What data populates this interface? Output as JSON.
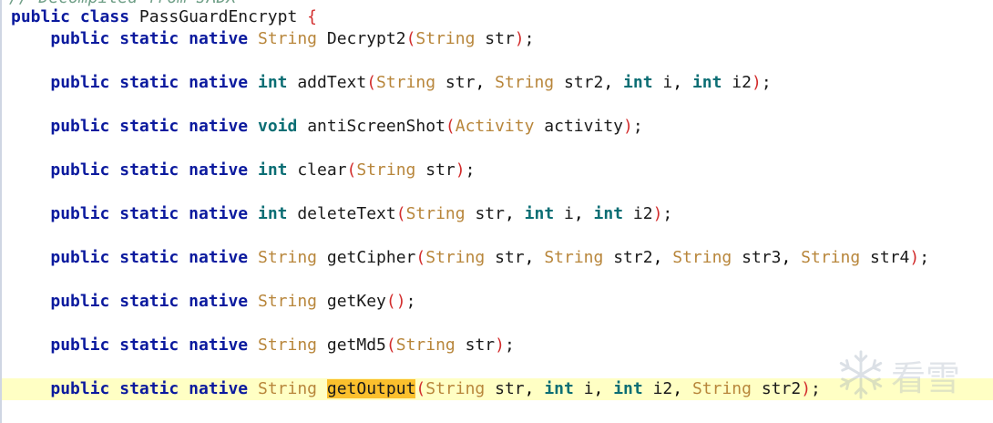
{
  "editor": {
    "top_comment_partial": "// Decompiled from JADX",
    "class_header": {
      "modifiers": [
        "public",
        "class"
      ],
      "name": "PassGuardEncrypt",
      "brace": "{"
    },
    "methods": [
      {
        "modifiers": [
          "public",
          "static",
          "native"
        ],
        "return_type": "String",
        "name": "Decrypt2",
        "params": [
          {
            "type": "String",
            "name": "str"
          }
        ]
      },
      {
        "modifiers": [
          "public",
          "static",
          "native"
        ],
        "return_type": "int",
        "name": "addText",
        "params": [
          {
            "type": "String",
            "name": "str"
          },
          {
            "type": "String",
            "name": "str2"
          },
          {
            "type": "int",
            "name": "i"
          },
          {
            "type": "int",
            "name": "i2"
          }
        ]
      },
      {
        "modifiers": [
          "public",
          "static",
          "native"
        ],
        "return_type": "void",
        "name": "antiScreenShot",
        "params": [
          {
            "type": "Activity",
            "name": "activity"
          }
        ]
      },
      {
        "modifiers": [
          "public",
          "static",
          "native"
        ],
        "return_type": "int",
        "name": "clear",
        "params": [
          {
            "type": "String",
            "name": "str"
          }
        ]
      },
      {
        "modifiers": [
          "public",
          "static",
          "native"
        ],
        "return_type": "int",
        "name": "deleteText",
        "params": [
          {
            "type": "String",
            "name": "str"
          },
          {
            "type": "int",
            "name": "i"
          },
          {
            "type": "int",
            "name": "i2"
          }
        ]
      },
      {
        "modifiers": [
          "public",
          "static",
          "native"
        ],
        "return_type": "String",
        "name": "getCipher",
        "params": [
          {
            "type": "String",
            "name": "str"
          },
          {
            "type": "String",
            "name": "str2"
          },
          {
            "type": "String",
            "name": "str3"
          },
          {
            "type": "String",
            "name": "str4"
          }
        ]
      },
      {
        "modifiers": [
          "public",
          "static",
          "native"
        ],
        "return_type": "String",
        "name": "getKey",
        "params": []
      },
      {
        "modifiers": [
          "public",
          "static",
          "native"
        ],
        "return_type": "String",
        "name": "getMd5",
        "params": [
          {
            "type": "String",
            "name": "str"
          }
        ]
      },
      {
        "modifiers": [
          "public",
          "static",
          "native"
        ],
        "return_type": "String",
        "name": "getOutput",
        "params": [
          {
            "type": "String",
            "name": "str"
          },
          {
            "type": "int",
            "name": "i"
          },
          {
            "type": "int",
            "name": "i2"
          },
          {
            "type": "String",
            "name": "str2"
          }
        ],
        "highlighted": true,
        "name_selected": true
      }
    ]
  },
  "watermark": {
    "text": "看雪",
    "icon": "snowflake-icon"
  },
  "colors": {
    "keyword": "#0b1a9e",
    "reference_type": "#b8863b",
    "primitive_type": "#0b6e74",
    "paren": "#d22c2c",
    "line_highlight": "#ffffc4",
    "selection": "#fbc02d"
  }
}
